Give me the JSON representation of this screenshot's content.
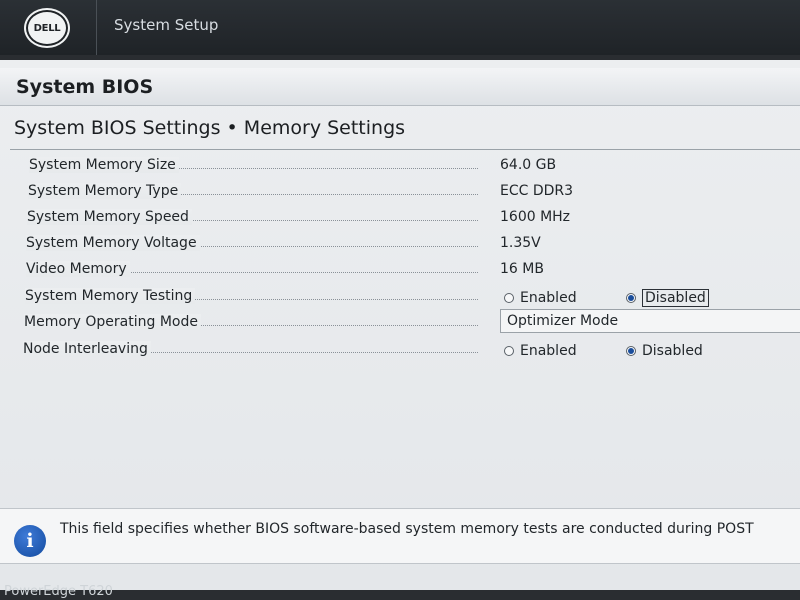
{
  "header": {
    "logo_text": "DELL",
    "app_title": "System Setup"
  },
  "section": {
    "title": "System BIOS"
  },
  "page": {
    "title": "System BIOS Settings • Memory Settings"
  },
  "settings": {
    "memory_size": {
      "label": "System Memory Size",
      "value": "64.0 GB"
    },
    "memory_type": {
      "label": "System Memory Type",
      "value": "ECC DDR3"
    },
    "memory_speed": {
      "label": "System Memory Speed",
      "value": "1600 MHz"
    },
    "memory_voltage": {
      "label": "System Memory Voltage",
      "value": "1.35V"
    },
    "video_memory": {
      "label": "Video Memory",
      "value": "16 MB"
    },
    "memory_testing": {
      "label": "System Memory Testing",
      "options": [
        "Enabled",
        "Disabled"
      ],
      "selected": "Disabled"
    },
    "operating_mode": {
      "label": "Memory Operating Mode",
      "value": "Optimizer Mode"
    },
    "node_interleaving": {
      "label": "Node Interleaving",
      "options": [
        "Enabled",
        "Disabled"
      ],
      "selected": "Disabled"
    }
  },
  "help": {
    "icon": "info-icon",
    "text": "This field specifies whether BIOS software-based system memory tests are conducted during POST"
  },
  "footer": {
    "model": "PowerEdge T620"
  },
  "colors": {
    "accent": "#1b4e9c",
    "header_bg": "#1f2327",
    "panel_bg": "#eceef0"
  }
}
